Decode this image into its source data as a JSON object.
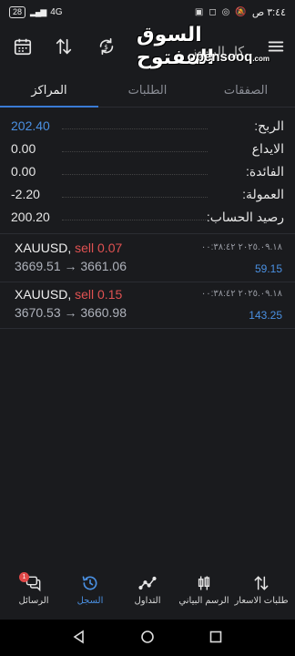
{
  "status_bar": {
    "time": "٣:٤٤ ص",
    "battery": "28",
    "network": "4G"
  },
  "toolbar": {
    "title": "كل الرموز"
  },
  "watermark": {
    "arabic": "السوق المفتوح",
    "english": "opensooq",
    "domain": ".com"
  },
  "tabs": [
    {
      "label": "الصفقات"
    },
    {
      "label": "الطلبات"
    },
    {
      "label": "المراكز"
    }
  ],
  "summary": [
    {
      "label": "الربح:",
      "value": "202.40"
    },
    {
      "label": "الايداع",
      "value": "0.00"
    },
    {
      "label": "الفائدة:",
      "value": "0.00"
    },
    {
      "label": "العمولة:",
      "value": "-2.20"
    },
    {
      "label": "رصيد الحساب:",
      "value": "200.20"
    }
  ],
  "positions": [
    {
      "symbol": "XAUUSD,",
      "side": "sell 0.07",
      "open_price": "3669.51",
      "arrow": "→",
      "close_price": "3661.06",
      "datetime": "٢٠٢٥.٠٩.١٨ ٠٠:٣٨:٤٢",
      "profit": "59.15"
    },
    {
      "symbol": "XAUUSD,",
      "side": "sell 0.15",
      "open_price": "3670.53",
      "arrow": "→",
      "close_price": "3660.98",
      "datetime": "٢٠٢٥.٠٩.١٨ ٠٠:٣٨:٤٢",
      "profit": "143.25"
    }
  ],
  "bottom_nav": [
    {
      "label": "طلبات الاسعار",
      "icon": "quotes-icon"
    },
    {
      "label": "الرسم البياني",
      "icon": "chart-icon"
    },
    {
      "label": "التداول",
      "icon": "trade-icon"
    },
    {
      "label": "السجل",
      "icon": "history-icon"
    },
    {
      "label": "الرسائل",
      "icon": "messages-icon",
      "badge": "1"
    }
  ],
  "colors": {
    "accent": "#4a90e2",
    "sell": "#e05252",
    "background": "#1a1b1e"
  }
}
